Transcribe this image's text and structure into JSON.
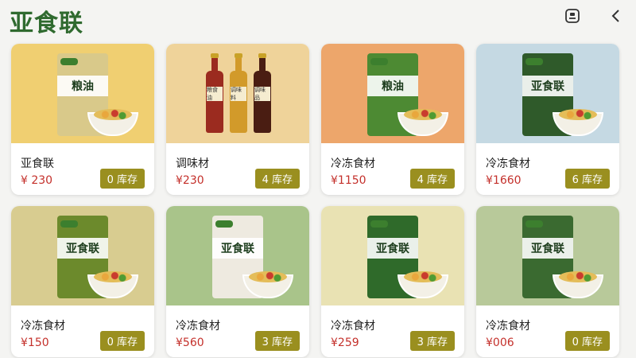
{
  "header": {
    "title": "亚食联",
    "icons": [
      "scan-icon",
      "back-chevron-icon"
    ]
  },
  "products": [
    {
      "name": "亚食联",
      "price": "¥ 230",
      "stock": "0 库存",
      "bag_text": "粮油",
      "bg": "#f0cf71",
      "bag": "#d9c98a"
    },
    {
      "name": "调味材",
      "price": "¥230",
      "stock": "4 库存",
      "bag_text": "",
      "bg": "#efd39a",
      "bag": ""
    },
    {
      "name": "冷冻食材",
      "price": "¥1150",
      "stock": "4 库存",
      "bag_text": "粮油",
      "bg": "#eda66b",
      "bag": "#4d8a33"
    },
    {
      "name": "冷冻食材",
      "price": "¥1660",
      "stock": "6 库存",
      "bag_text": "亚食联",
      "bg": "#c5d9e3",
      "bag": "#2f5a2a"
    },
    {
      "name": "冷冻食材",
      "price": "¥150",
      "stock": "0 库存",
      "bag_text": "亚食联",
      "bg": "#d8cc90",
      "bag": "#6c8a2c"
    },
    {
      "name": "冷冻食材",
      "price": "¥560",
      "stock": "3 库存",
      "bag_text": "亚食联",
      "bg": "#a9c48a",
      "bag": "#eeeae0"
    },
    {
      "name": "冷冻食材",
      "price": "¥259",
      "stock": "3 库存",
      "bag_text": "亚食联",
      "bg": "#e9e2b3",
      "bag": "#2f6a2a"
    },
    {
      "name": "冷冻食材",
      "price": "¥006",
      "stock": "0 库存",
      "bag_text": "亚食联",
      "bg": "#b8c99a",
      "bag": "#3a6a30"
    }
  ],
  "bottles": [
    {
      "label": "粮食油",
      "color": "#9b2b1f"
    },
    {
      "label": "调味料",
      "color": "#d29a2a"
    },
    {
      "label": "调味品",
      "color": "#4a1d12"
    }
  ],
  "colors": {
    "title": "#2f6a2f",
    "price": "#c4302b",
    "stock_badge": "#9a8f1f"
  }
}
